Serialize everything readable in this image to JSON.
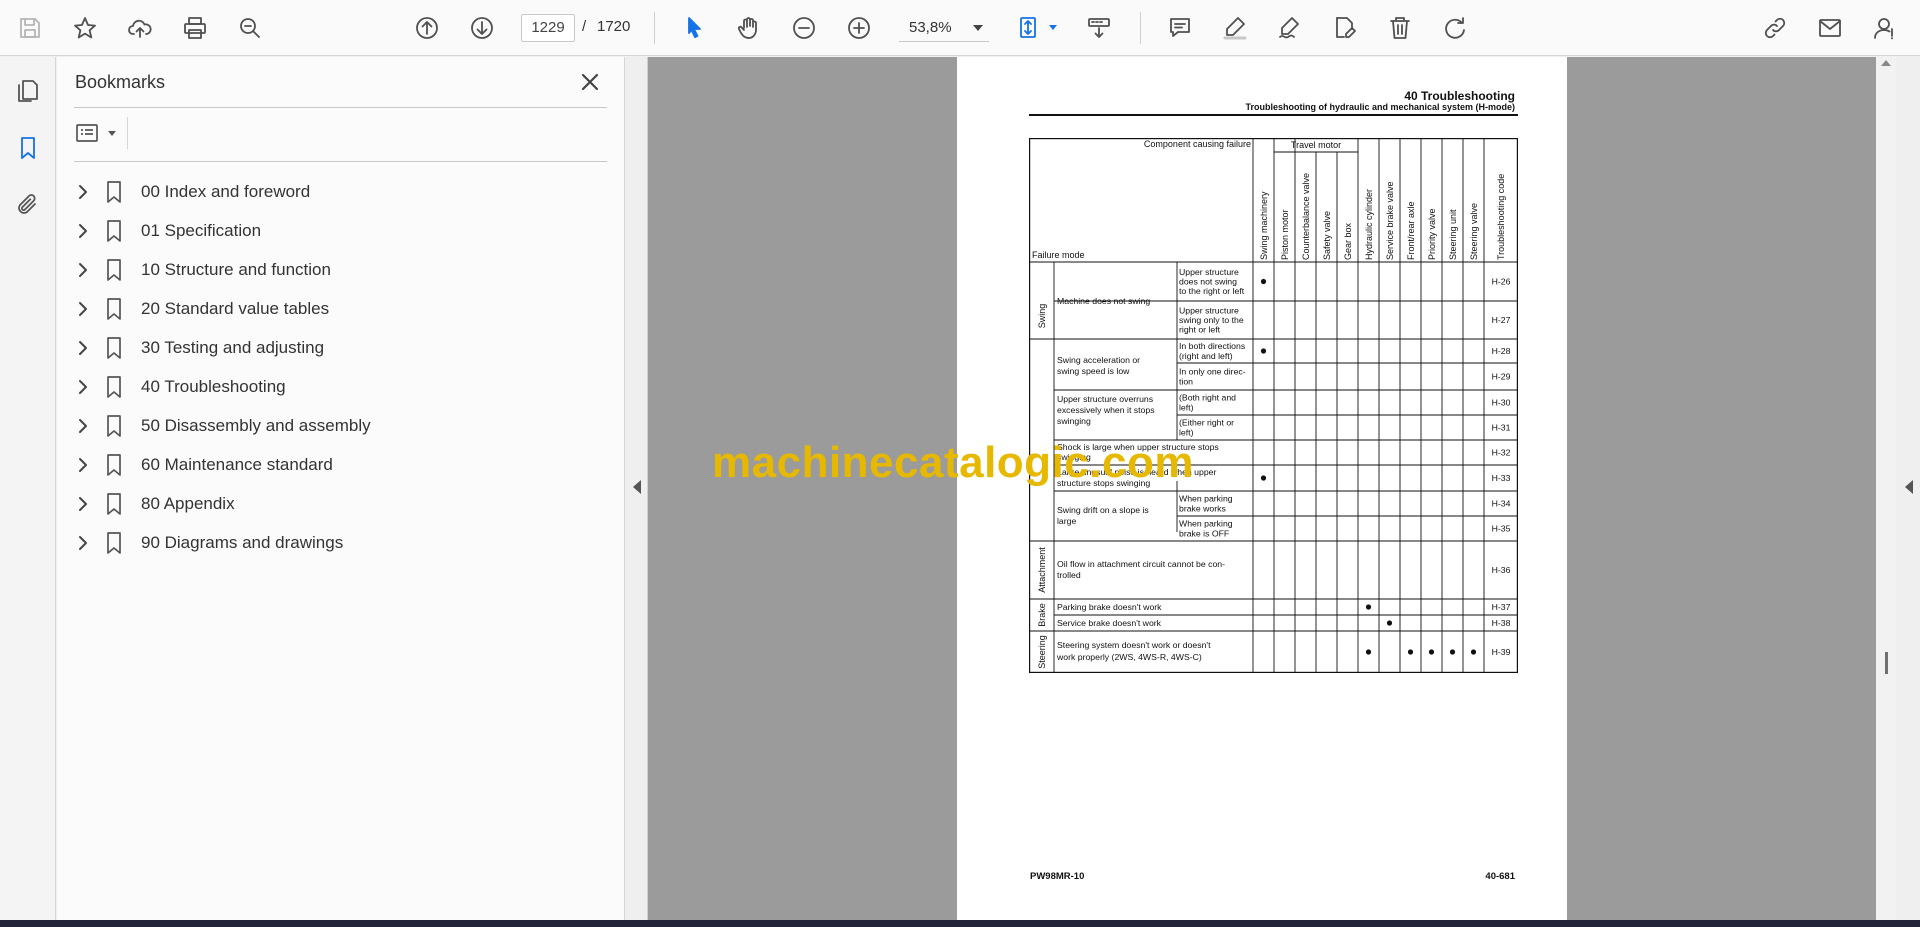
{
  "toolbar": {
    "page_current": "1229",
    "page_separator": "/",
    "page_total": "1720",
    "zoom": "53,8%"
  },
  "bookmarks_panel": {
    "title": "Bookmarks",
    "items": [
      {
        "label": "00 Index and foreword"
      },
      {
        "label": "01 Specification"
      },
      {
        "label": "10 Structure and function"
      },
      {
        "label": "20 Standard value tables"
      },
      {
        "label": "30 Testing and adjusting"
      },
      {
        "label": "40 Troubleshooting"
      },
      {
        "label": "50 Disassembly and assembly"
      },
      {
        "label": "60 Maintenance standard"
      },
      {
        "label": "80 Appendix"
      },
      {
        "label": "90 Diagrams and drawings"
      }
    ]
  },
  "document": {
    "header_title": "40 Troubleshooting",
    "header_subtitle": "Troubleshooting of hydraulic and mechanical system (H-mode)",
    "footer_left": "PW98MR-10",
    "footer_right": "40-681",
    "watermark": "machinecatalogic.com",
    "table": {
      "corner_top": "Component causing failure",
      "corner_bottom": "Failure mode",
      "travel_motor_group": "Travel motor",
      "columns": [
        "Swing machinery",
        "Piston motor",
        "Counterbalance valve",
        "Safety valve",
        "Gear box",
        "Hydraulic cylinder",
        "Service brake valve",
        "Front/rear axle",
        "Priority valve",
        "Steering unit",
        "Steering valve",
        "Troubleshooting code"
      ],
      "categories": [
        "Swing",
        "Attachment",
        "Brake",
        "Steering"
      ],
      "rows": [
        {
          "mode": "Machine does not swing",
          "sub": [
            "Upper structure",
            "does not swing",
            "to the right or left"
          ],
          "code": "H-26",
          "dots": [
            0
          ]
        },
        {
          "mode": "",
          "sub": [
            "Upper structure",
            "swing only to the",
            "right or left"
          ],
          "code": "H-27",
          "dots": []
        },
        {
          "mode": "Swing acceleration or swing speed is low",
          "sub": [
            "In both directions",
            "(right and left)"
          ],
          "code": "H-28",
          "dots": [
            0
          ]
        },
        {
          "mode": "",
          "sub": [
            "In only one direc-",
            "tion"
          ],
          "code": "H-29",
          "dots": []
        },
        {
          "mode": "Upper structure overruns excessively when it stops swinging",
          "sub": [
            "(Both right and",
            "left)"
          ],
          "code": "H-30",
          "dots": []
        },
        {
          "mode": "",
          "sub": [
            "(Either right or",
            "left)"
          ],
          "code": "H-31",
          "dots": []
        },
        {
          "mode": "Shock is large when upper structure stops swinging",
          "sub": [],
          "code": "H-32",
          "dots": []
        },
        {
          "mode": "Large unusual noise is heard when upper structure stops swinging",
          "sub": [],
          "code": "H-33",
          "dots": [
            0
          ]
        },
        {
          "mode": "Swing drift on a slope is large",
          "sub": [
            "When parking",
            "brake works"
          ],
          "code": "H-34",
          "dots": []
        },
        {
          "mode": "",
          "sub": [
            "When parking",
            "brake is OFF"
          ],
          "code": "H-35",
          "dots": []
        },
        {
          "mode": "Oil flow in attachment circuit cannot be controlled",
          "sub": [],
          "code": "H-36",
          "dots": []
        },
        {
          "mode": "Parking brake doesn't work",
          "sub": [],
          "code": "H-37",
          "dots": [
            5
          ]
        },
        {
          "mode": "Service brake doesn't work",
          "sub": [],
          "code": "H-38",
          "dots": [
            6
          ]
        },
        {
          "mode": "Steering system doesn't work or doesn't work properly (2WS, 4WS-R, 4WS-C)",
          "sub": [],
          "code": "H-39",
          "dots": [
            5,
            7,
            8,
            9,
            10
          ]
        }
      ],
      "row_text": {
        "r0_mode": "Machine does not swing",
        "r2_mode_l1": "Swing acceleration or",
        "r2_mode_l2": "swing speed is low",
        "r4_mode_l1": "Upper structure overruns",
        "r4_mode_l2": "excessively when it stops",
        "r4_mode_l3": "swinging",
        "r6_mode_l1": "Shock is large when upper structure stops",
        "r6_mode_l2": "swinging",
        "r7_mode_l1": "Large unusual noise is heard when upper",
        "r7_mode_l2": "structure stops swinging",
        "r8_mode_l1": "Swing drift on a slope is",
        "r8_mode_l2": "large",
        "r10_mode_l1": "Oil flow in attachment circuit cannot be con-",
        "r10_mode_l2": "trolled",
        "r11_mode": "Parking brake doesn't work",
        "r12_mode": "Service brake doesn't work",
        "r13_mode_l1": "Steering system doesn't work or doesn't",
        "r13_mode_l2": "work properly (2WS, 4WS-R, 4WS-C)"
      }
    }
  }
}
